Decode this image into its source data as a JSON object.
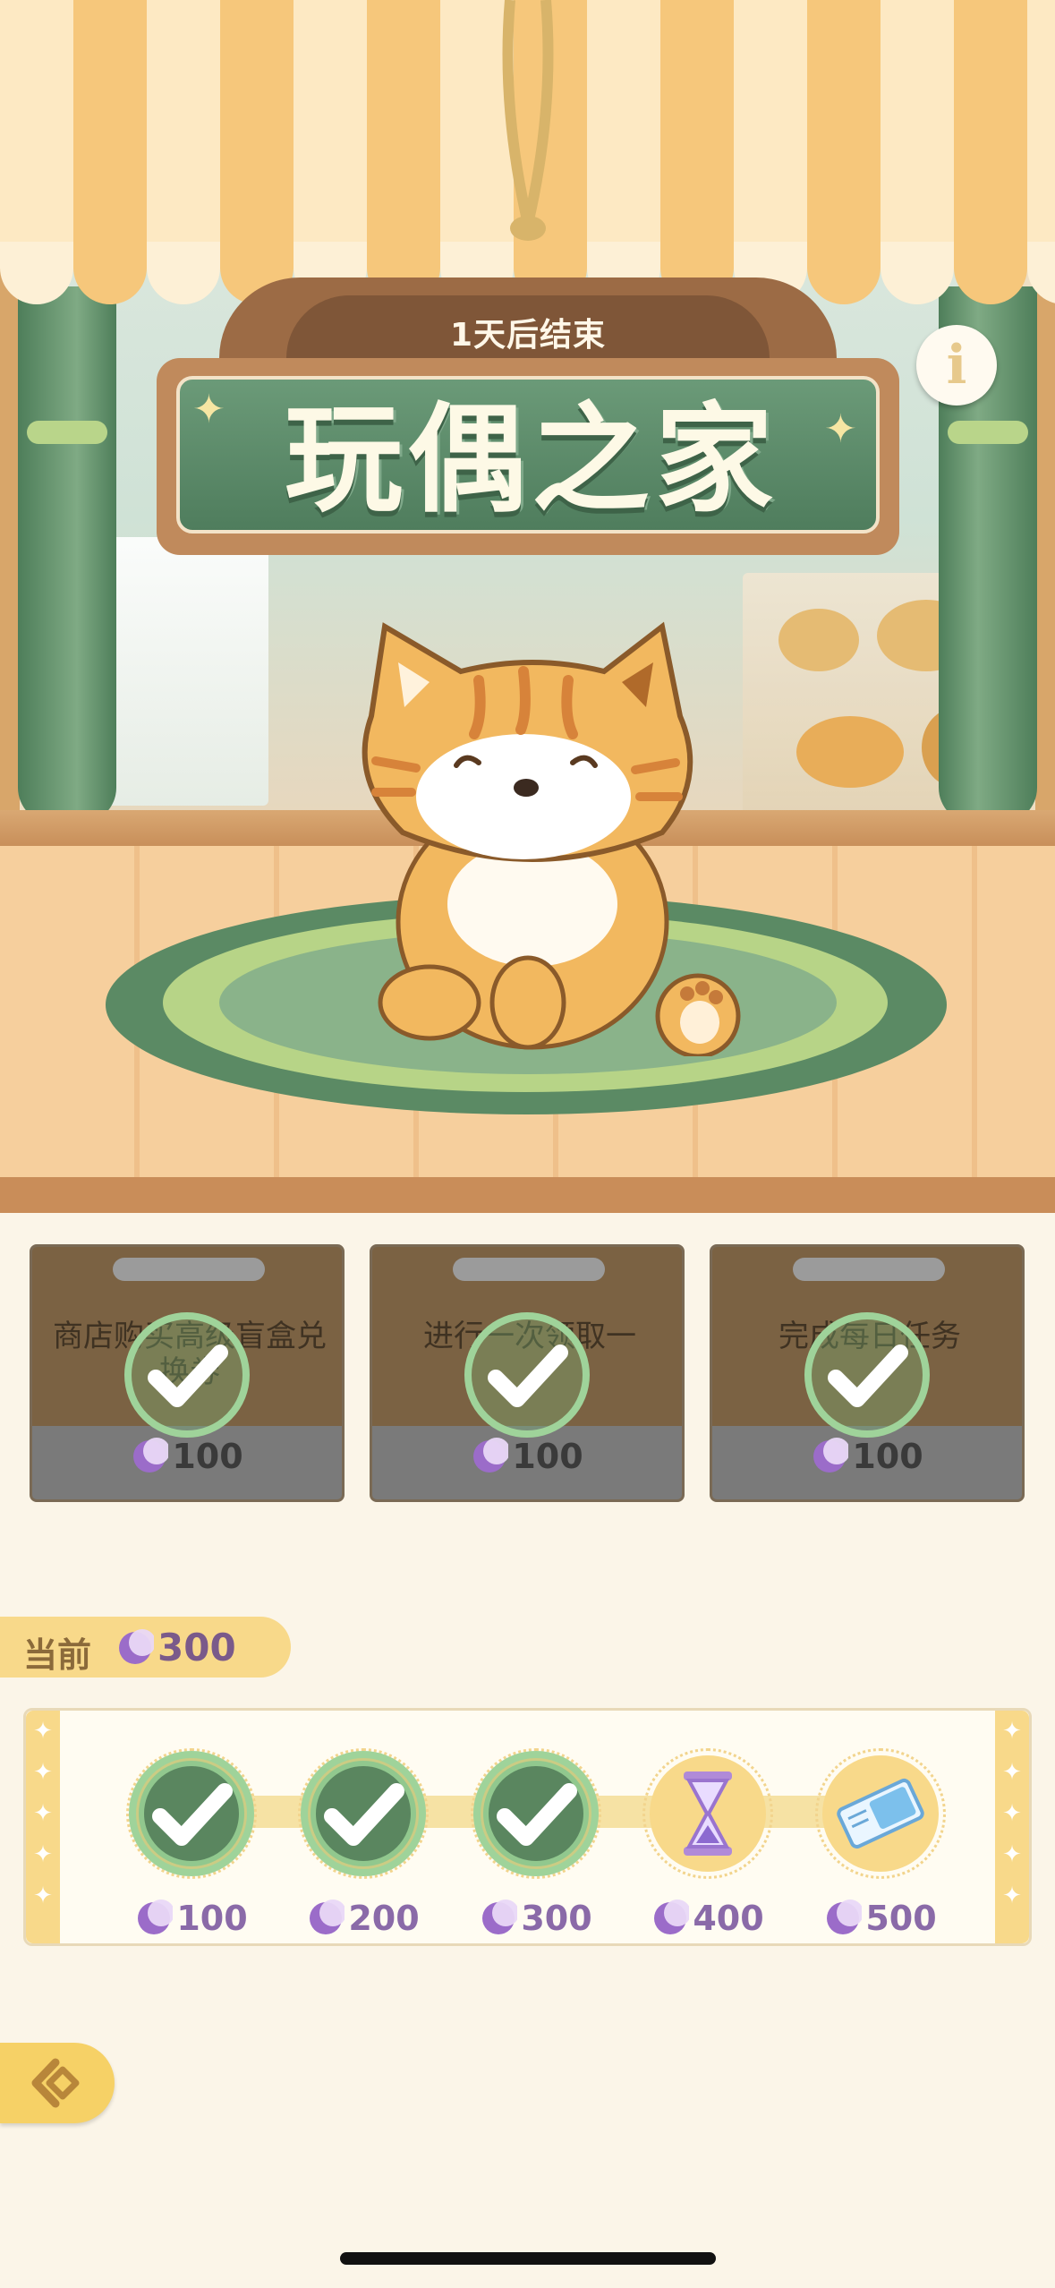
{
  "event": {
    "ends_label": "1天后结束",
    "title": "玩偶之家",
    "info_icon": "info-icon",
    "info_glyph": "i"
  },
  "tasks": [
    {
      "description": "商店购买高级盲盒兑换券",
      "reward": "100",
      "completed": true
    },
    {
      "description": "进行一次领取一",
      "reward": "100",
      "completed": true
    },
    {
      "description": "完成每日任务",
      "reward": "100",
      "completed": true
    }
  ],
  "progress": {
    "current_label": "当前",
    "current_value": "300",
    "milestones": [
      {
        "cost": "100",
        "reward_icon": "gift-icon",
        "claimed": true
      },
      {
        "cost": "200",
        "reward_icon": "gift-icon",
        "claimed": true
      },
      {
        "cost": "300",
        "reward_icon": "gift-icon",
        "claimed": true
      },
      {
        "cost": "400",
        "reward_icon": "hourglass-icon",
        "claimed": false
      },
      {
        "cost": "500",
        "reward_icon": "ticket-icon",
        "claimed": false
      }
    ]
  },
  "colors": {
    "accent": "#f8d98a",
    "moon_currency": "#9b6cc9",
    "check_green": "#9fd39a",
    "sign_green": "#5a8a68"
  }
}
